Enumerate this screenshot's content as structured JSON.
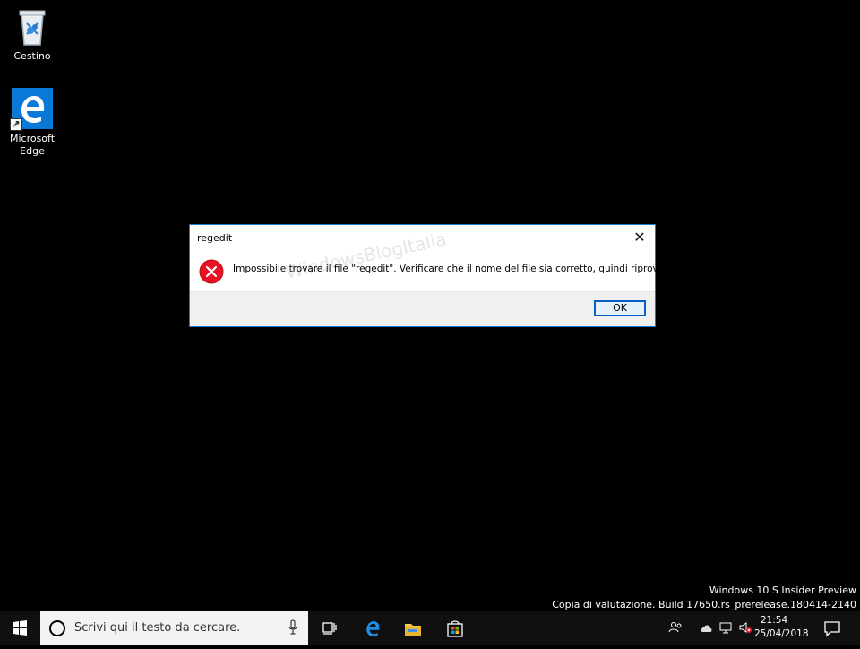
{
  "desktop": {
    "icons": [
      {
        "label": "Cestino"
      },
      {
        "label": "Microsoft Edge"
      }
    ]
  },
  "dialog": {
    "title": "regedit",
    "message": "Impossibile trovare il file \"regedit\". Verificare che il nome del file sia corretto, quindi riprovare.",
    "ok_label": "OK",
    "close_glyph": "✕",
    "watermark": "WindowsBlogItalia"
  },
  "os_info": {
    "line1": "Windows 10 S Insider Preview",
    "line2": "Copia di valutazione. Build 17650.rs_prerelease.180414-2140"
  },
  "taskbar": {
    "search_placeholder": "Scrivi qui il testo da cercare.",
    "time": "21:54",
    "date": "25/04/2018"
  },
  "colors": {
    "accent": "#0a78d7",
    "error": "#e81123",
    "desktop_bg": "#000000"
  }
}
